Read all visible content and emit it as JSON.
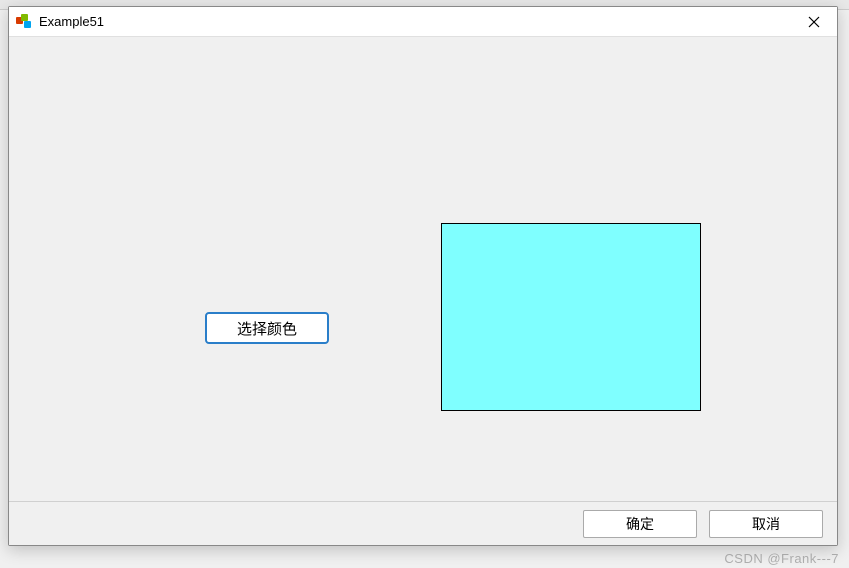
{
  "dialog": {
    "title": "Example51",
    "select_color_label": "选择颜色",
    "color_value": "#7fffff",
    "ok_label": "确定",
    "cancel_label": "取消"
  },
  "watermark": "CSDN @Frank---7"
}
